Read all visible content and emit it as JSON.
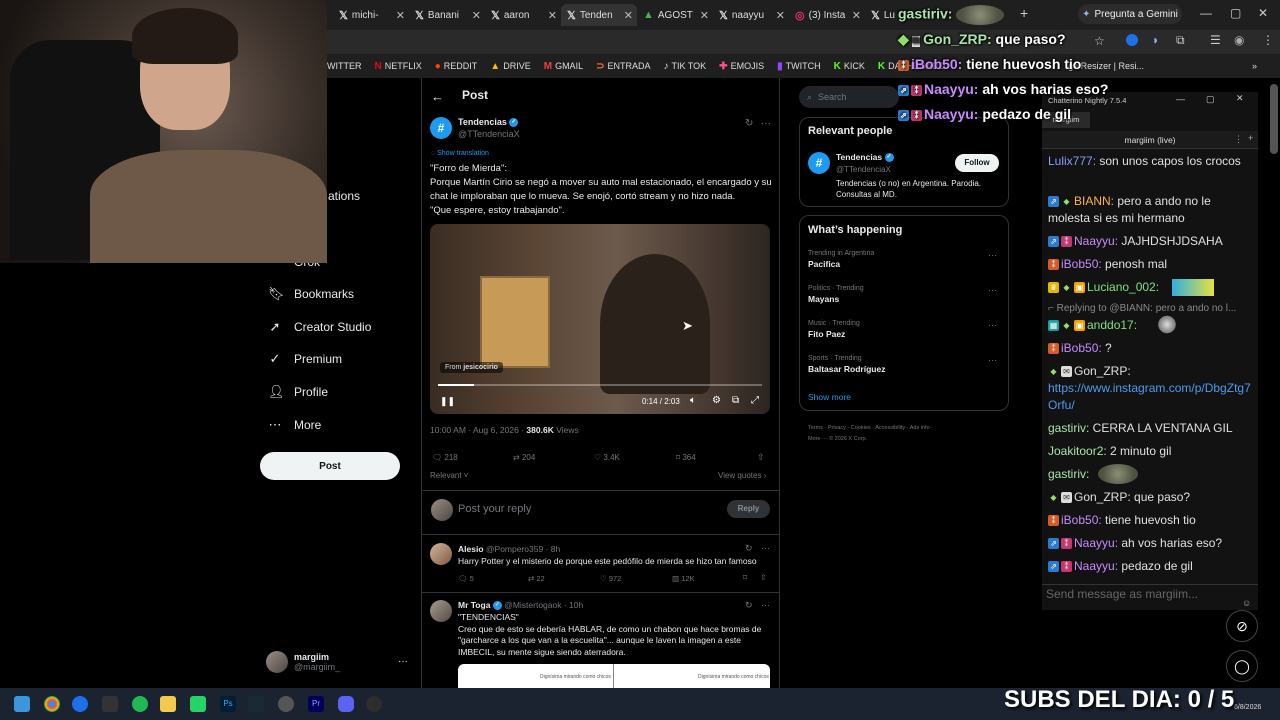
{
  "browser": {
    "tabs": [
      {
        "label": "michi-",
        "icon": "x"
      },
      {
        "label": "Banani",
        "icon": "x"
      },
      {
        "label": "aaron",
        "icon": "x"
      },
      {
        "label": "Tenden",
        "icon": "x"
      },
      {
        "label": "AGOST",
        "icon": "drive"
      },
      {
        "label": "naayyu",
        "icon": "x"
      },
      {
        "label": "(3) Insta",
        "icon": "instagram"
      },
      {
        "label": "Lu",
        "icon": "x"
      }
    ],
    "gemini_label": "Pregunta a Gemini",
    "bookmarks": [
      {
        "label": "WITTER",
        "icon": "x"
      },
      {
        "label": "NETFLIX",
        "icon": "netflix"
      },
      {
        "label": "REDDIT",
        "icon": "reddit"
      },
      {
        "label": "DRIVE",
        "icon": "drive"
      },
      {
        "label": "GMAIL",
        "icon": "gmail"
      },
      {
        "label": "ENTRADA",
        "icon": "entrada"
      },
      {
        "label": "TIK TOK",
        "icon": "tiktok"
      },
      {
        "label": "EMOJIS",
        "icon": "emojis"
      },
      {
        "label": "TWITCH",
        "icon": "twitch"
      },
      {
        "label": "KICK",
        "icon": "kick"
      },
      {
        "label": "DASHBOARD",
        "icon": "kick"
      }
    ],
    "bookmark_overflow": "ge Resizer | Resi..."
  },
  "nav": {
    "partial_1": "e",
    "partial_2": "ations",
    "partial_3": "Grok",
    "items": [
      "Bookmarks",
      "Creator Studio",
      "Premium",
      "Profile",
      "More"
    ],
    "post_button": "Post",
    "user_name": "margiim",
    "user_handle": "@margiim_"
  },
  "post_header": {
    "title": "Post"
  },
  "post": {
    "author": "Tendencias",
    "handle": "@TTendenciaX",
    "show_translation": "Show translation",
    "text_1": "\"Forro de Mierda\":",
    "text_2": "Porque Martín Cirio se negó a mover su auto mal estacionado, el encargado y su chat le imploraban que lo mueva. Se enojó, cortó stream y no hizo nada.",
    "text_3": "\"Que espere, estoy trabajando\".",
    "video_from": "From",
    "video_source": "jesicocirio",
    "video_time": "0:14 / 2:03",
    "video_progress": 0.11,
    "timestamp": "10:00 AM · Aug 6, 2026 ·",
    "views_count": "380.6K",
    "views_label": "Views",
    "replies": "218",
    "reposts": "204",
    "likes": "3.4K",
    "bookmarks": "364",
    "relevant": "Relevant",
    "view_quotes": "View quotes",
    "reply_placeholder": "Post your reply",
    "reply_button": "Reply"
  },
  "replies": [
    {
      "name": "Alesio",
      "handle": "@Pompero359 · 8h",
      "text": "Harry Potter y el misterio de porque este pedófilo de mierda se hizo tan famoso",
      "replies": "5",
      "reposts": "22",
      "likes": "972",
      "views": "12K"
    },
    {
      "name": "Mr Toga",
      "handle": "@Mistertogaok · 10h",
      "text_1": "\"TENDENCIAS\"",
      "text_2": "Creo que de esto se debería HABLAR, de como un chabon que hace bromas de \"garcharce a los que van a la escuelita\"... aunque le laven la imagen a este IMBECIL, su mente sigue siendo aterradora.",
      "quote_caption": "Dignísima mirando como chicos"
    }
  ],
  "sidebar": {
    "search_placeholder": "Search",
    "relevant_title": "Relevant people",
    "person_name": "Tendencias",
    "person_handle": "@TTendenciaX",
    "person_bio": "Tendencias (o no) en Argentina. Parodia. Consultas al MD.",
    "follow": "Follow",
    "happening_title": "What’s happening",
    "trends": [
      {
        "meta": "Trending in Argentina",
        "name": "Pacifica"
      },
      {
        "meta": "Politics · Trending",
        "name": "Mayans"
      },
      {
        "meta": "Music · Trending",
        "name": "Fito Paez"
      },
      {
        "meta": "Sports · Trending",
        "name": "Baltasar Rodríguez"
      }
    ],
    "show_more": "Show more",
    "footer_1": "Terms · Privacy · Cookies · Accessibility · Ads info ·",
    "footer_2": "More ··· © 2026 X Corp."
  },
  "chatterino": {
    "title": "Chatterino Nightly 7.5.4",
    "tab": "margiim",
    "channel": "margiim (live)",
    "input_placeholder": "Send message as margiim...",
    "messages": [
      {
        "user": "Lulix777:",
        "text": " son unos capos los crocos",
        "color": "#8a9cff"
      },
      {
        "user": "BIANN:",
        "text": " pero a ando no le molesta si es mi hermano",
        "color": "#ffb347"
      },
      {
        "user": "Naayyu:",
        "text": " JAJHDSHJDSAHA",
        "color": "#c78bff"
      },
      {
        "user": "iBob50:",
        "text": " penosh mal",
        "color": "#c78bff"
      },
      {
        "user": "Luciano_002:",
        "text": "",
        "color": "#80e080"
      },
      {
        "reply": "Replying to @BIANN: pero a ando no l..."
      },
      {
        "user": "anddo17:",
        "text": "",
        "color": "#80e080"
      },
      {
        "user": "iBob50:",
        "text": " ?",
        "color": "#c78bff"
      },
      {
        "user": "Gon_ZRP:",
        "text": "",
        "color": "#e0e0e0",
        "link": "https://www.instagram.com/p/DbgZtg7Orfu/"
      },
      {
        "user": "gastiriv:",
        "text": " CERRA LA VENTANA GIL",
        "color": "#a9e5a9"
      },
      {
        "user": "Joakitoor2:",
        "text": " 2 minuto gil",
        "color": "#a9e5a9"
      },
      {
        "user": "gastiriv:",
        "text": "",
        "color": "#a9e5a9"
      },
      {
        "user": "Gon_ZRP:",
        "text": " que paso?",
        "color": "#e0e0e0"
      },
      {
        "user": "iBob50:",
        "text": " tiene huevosh tio",
        "color": "#c78bff"
      },
      {
        "user": "Naayyu:",
        "text": " ah vos harias eso?",
        "color": "#c78bff"
      },
      {
        "user": "Naayyu:",
        "text": " pedazo de gil",
        "color": "#c78bff"
      }
    ]
  },
  "overlay_chat": [
    {
      "user": "gastiriv:",
      "text": ""
    },
    {
      "user": "Gon_ZRP:",
      "text": " que paso?"
    },
    {
      "user": "iBob50:",
      "text": " tiene huevosh tio"
    },
    {
      "user": "Naayyu:",
      "text": " ah vos harias eso?"
    },
    {
      "user": "Naayyu:",
      "text": " pedazo de gil"
    }
  ],
  "subs_counter": "SUBS DEL DIA: 0 / 5",
  "taskbar_date": "6/8/2026",
  "colors": {
    "accent": "#1d9bf0",
    "background": "#000000",
    "taskbar": "#1c2330"
  }
}
